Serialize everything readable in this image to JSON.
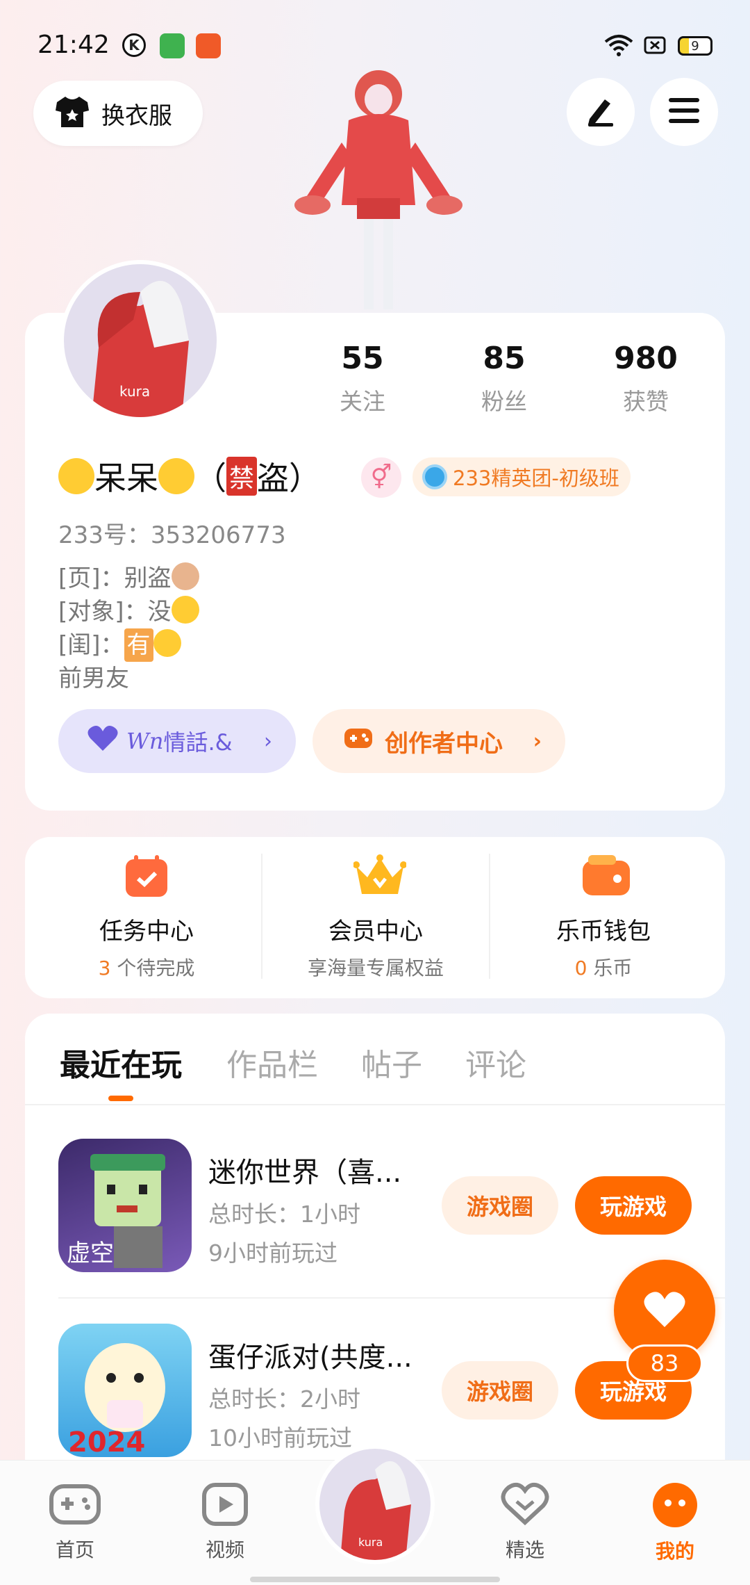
{
  "status_bar": {
    "time": "21:42",
    "battery": "9",
    "icons": [
      "k-icon",
      "android-app-icon",
      "app-icon",
      "wifi-icon",
      "sim-off-icon",
      "battery-icon"
    ]
  },
  "header": {
    "outfit_label": "换衣服",
    "edit_icon": "pen-icon",
    "menu_icon": "menu-icon"
  },
  "profile": {
    "stats": [
      {
        "value": "55",
        "label": "关注"
      },
      {
        "value": "85",
        "label": "粉丝"
      },
      {
        "value": "980",
        "label": "获赞"
      }
    ],
    "nickname_main": "呆呆",
    "nickname_paren_open": "（",
    "nickname_ban": "禁",
    "nickname_tail": "盗）",
    "gender_symbol": "⚥",
    "team_badge": "233精英团-初级班",
    "uid": "233号：353206773",
    "bio_lines": {
      "line1": "[页]：别盗",
      "line2": "[对象]：没",
      "line3_prefix": "[闺]：",
      "line3_box": "有",
      "line4": "前男友"
    },
    "pill_purple_label": "情話.&",
    "pill_purple_script": "Wn",
    "pill_orange_label": "创作者中心"
  },
  "services": [
    {
      "title": "任务中心",
      "count": "3",
      "sub": " 个待完成"
    },
    {
      "title": "会员中心",
      "sub": "享海量专属权益"
    },
    {
      "title": "乐币钱包",
      "count": "0",
      "sub": " 乐币"
    }
  ],
  "tabs": [
    "最近在玩",
    "作品栏",
    "帖子",
    "评论"
  ],
  "games": [
    {
      "title": "迷你世界（喜...",
      "duration": "总时长：1小时",
      "last_played": "9小时前玩过",
      "circle_btn": "游戏圈",
      "play_btn": "玩游戏",
      "icon_text": "虚空"
    },
    {
      "title": "蛋仔派对(共度...",
      "duration": "总时长：2小时",
      "last_played": "10小时前玩过",
      "circle_btn": "游戏圈",
      "play_btn": "玩游戏",
      "icon_text": "2024"
    }
  ],
  "like_fab": {
    "count": "83"
  },
  "bottom_nav": [
    {
      "label": "首页"
    },
    {
      "label": "视频"
    },
    {
      "label": "精选"
    },
    {
      "label": "我的"
    }
  ],
  "colors": {
    "accent": "#ff6a00",
    "purple": "#6a5bdc"
  }
}
